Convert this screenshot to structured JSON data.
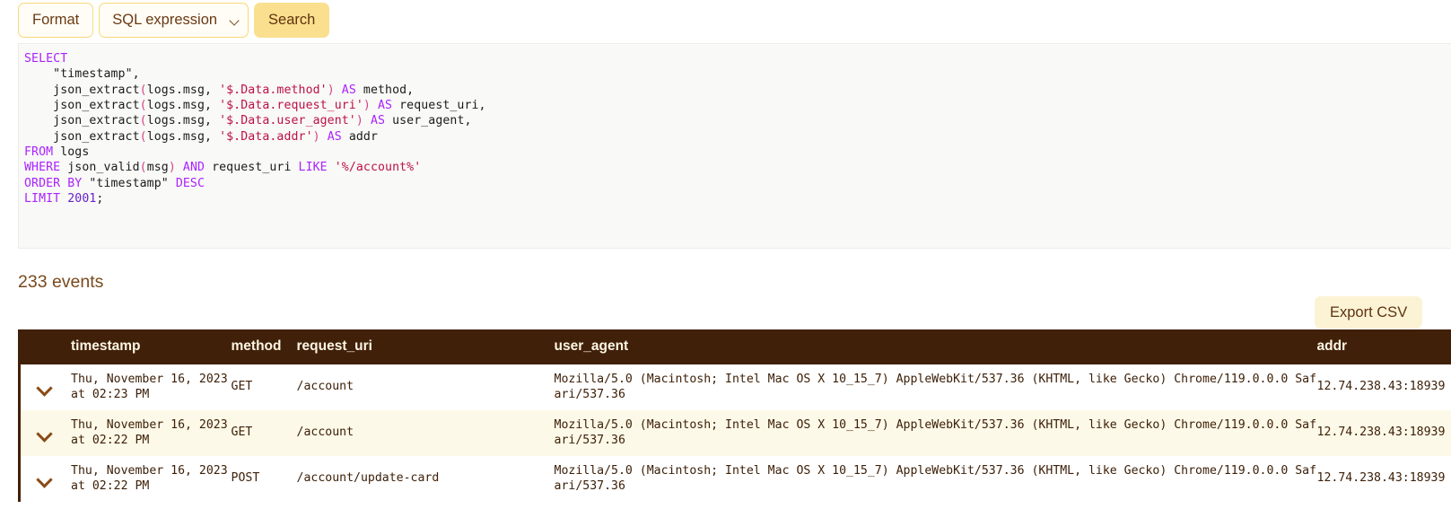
{
  "toolbar": {
    "format_label": "Format",
    "query_type_selected": "SQL expression",
    "query_type_options": [
      "SQL expression"
    ],
    "search_label": "Search",
    "dropdown_icon": "chevron-down-icon"
  },
  "editor": {
    "language": "sql",
    "lines": [
      [
        {
          "t": "SELECT",
          "c": "kw"
        }
      ],
      [
        {
          "t": "    ",
          "c": "plain"
        },
        {
          "t": "\"timestamp\",",
          "c": "plain"
        }
      ],
      [
        {
          "t": "    json_extract",
          "c": "plain"
        },
        {
          "t": "(",
          "c": "par"
        },
        {
          "t": "logs.msg, ",
          "c": "plain"
        },
        {
          "t": "'$.Data.method'",
          "c": "str"
        },
        {
          "t": ")",
          "c": "par"
        },
        {
          "t": " ",
          "c": "plain"
        },
        {
          "t": "AS",
          "c": "kw"
        },
        {
          "t": " method,",
          "c": "plain"
        }
      ],
      [
        {
          "t": "    json_extract",
          "c": "plain"
        },
        {
          "t": "(",
          "c": "par"
        },
        {
          "t": "logs.msg, ",
          "c": "plain"
        },
        {
          "t": "'$.Data.request_uri'",
          "c": "str"
        },
        {
          "t": ")",
          "c": "par"
        },
        {
          "t": " ",
          "c": "plain"
        },
        {
          "t": "AS",
          "c": "kw"
        },
        {
          "t": " request_uri,",
          "c": "plain"
        }
      ],
      [
        {
          "t": "    json_extract",
          "c": "plain"
        },
        {
          "t": "(",
          "c": "par"
        },
        {
          "t": "logs.msg, ",
          "c": "plain"
        },
        {
          "t": "'$.Data.user_agent'",
          "c": "str"
        },
        {
          "t": ")",
          "c": "par"
        },
        {
          "t": " ",
          "c": "plain"
        },
        {
          "t": "AS",
          "c": "kw"
        },
        {
          "t": " user_agent,",
          "c": "plain"
        }
      ],
      [
        {
          "t": "    json_extract",
          "c": "plain"
        },
        {
          "t": "(",
          "c": "par"
        },
        {
          "t": "logs.msg, ",
          "c": "plain"
        },
        {
          "t": "'$.Data.addr'",
          "c": "str"
        },
        {
          "t": ")",
          "c": "par"
        },
        {
          "t": " ",
          "c": "plain"
        },
        {
          "t": "AS",
          "c": "kw"
        },
        {
          "t": " addr",
          "c": "plain"
        }
      ],
      [
        {
          "t": "FROM",
          "c": "kw"
        },
        {
          "t": " logs",
          "c": "plain"
        }
      ],
      [
        {
          "t": "WHERE",
          "c": "kw"
        },
        {
          "t": " json_valid",
          "c": "plain"
        },
        {
          "t": "(",
          "c": "par"
        },
        {
          "t": "msg",
          "c": "plain"
        },
        {
          "t": ")",
          "c": "par"
        },
        {
          "t": " ",
          "c": "plain"
        },
        {
          "t": "AND",
          "c": "kw"
        },
        {
          "t": " request_uri ",
          "c": "plain"
        },
        {
          "t": "LIKE",
          "c": "kw"
        },
        {
          "t": " ",
          "c": "plain"
        },
        {
          "t": "'%/account%'",
          "c": "str"
        }
      ],
      [
        {
          "t": "ORDER BY",
          "c": "kw"
        },
        {
          "t": " \"timestamp\" ",
          "c": "plain"
        },
        {
          "t": "DESC",
          "c": "kw"
        }
      ],
      [
        {
          "t": "LIMIT",
          "c": "kw"
        },
        {
          "t": " ",
          "c": "plain"
        },
        {
          "t": "2001",
          "c": "num"
        },
        {
          "t": ";",
          "c": "plain"
        }
      ]
    ]
  },
  "results": {
    "count_label": "233 events",
    "export_label": "Export CSV",
    "columns": [
      "",
      "timestamp",
      "method",
      "request_uri",
      "user_agent",
      "addr"
    ],
    "rows": [
      {
        "expand_icon": "chevron-down-icon",
        "timestamp": "Thu, November 16, 2023 at 02:23 PM",
        "method": "GET",
        "request_uri": "/account",
        "user_agent": "Mozilla/5.0 (Macintosh; Intel Mac OS X 10_15_7) AppleWebKit/537.36 (KHTML, like Gecko) Chrome/119.0.0.0 Safari/537.36",
        "addr": "12.74.238.43:18939"
      },
      {
        "expand_icon": "chevron-down-icon",
        "timestamp": "Thu, November 16, 2023 at 02:22 PM",
        "method": "GET",
        "request_uri": "/account",
        "user_agent": "Mozilla/5.0 (Macintosh; Intel Mac OS X 10_15_7) AppleWebKit/537.36 (KHTML, like Gecko) Chrome/119.0.0.0 Safari/537.36",
        "addr": "12.74.238.43:18939"
      },
      {
        "expand_icon": "chevron-down-icon",
        "timestamp": "Thu, November 16, 2023 at 02:22 PM",
        "method": "POST",
        "request_uri": "/account/update-card",
        "user_agent": "Mozilla/5.0 (Macintosh; Intel Mac OS X 10_15_7) AppleWebKit/537.36 (KHTML, like Gecko) Chrome/119.0.0.0 Safari/537.36",
        "addr": "12.74.238.43:18939"
      }
    ]
  },
  "colors": {
    "header_bg": "#41200a",
    "header_fg": "#fdf6e3",
    "accent": "#fadf8e",
    "row_stripe": "#fdf9e8",
    "text": "#3d2008"
  }
}
